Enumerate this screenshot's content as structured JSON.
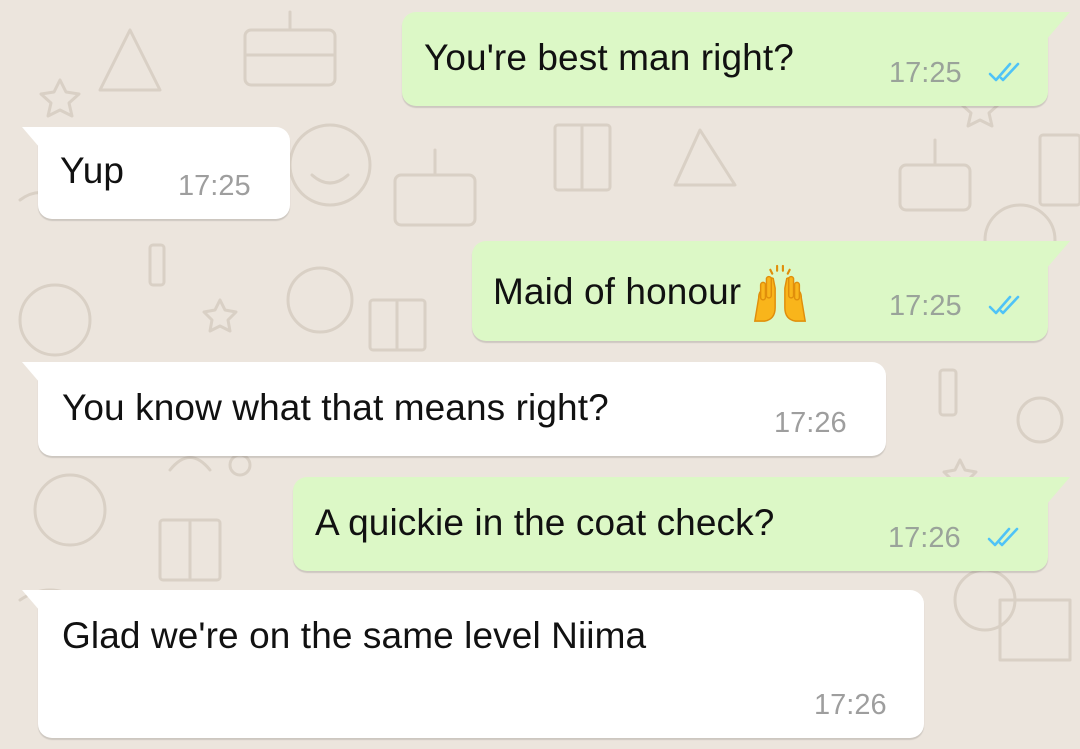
{
  "colors": {
    "outgoing_bubble": "#dcf8c6",
    "incoming_bubble": "#ffffff",
    "background": "#ece5dd",
    "read_ticks": "#4fc3f7",
    "timestamp": "#9aa39a"
  },
  "messages": [
    {
      "direction": "outgoing",
      "text": "You're best man right?",
      "time": "17:25",
      "status": "read",
      "status_icon": "double-check-icon"
    },
    {
      "direction": "incoming",
      "text": "Yup",
      "time": "17:25"
    },
    {
      "direction": "outgoing",
      "text": "Maid of honour",
      "emoji": "raising-hands-emoji",
      "time": "17:25",
      "status": "read",
      "status_icon": "double-check-icon"
    },
    {
      "direction": "incoming",
      "text": "You know what that means right?",
      "time": "17:26"
    },
    {
      "direction": "outgoing",
      "text": "A quickie in the coat check?",
      "time": "17:26",
      "status": "read",
      "status_icon": "double-check-icon"
    },
    {
      "direction": "incoming",
      "text": "Glad we're on the same level Niima",
      "time": "17:26"
    }
  ]
}
